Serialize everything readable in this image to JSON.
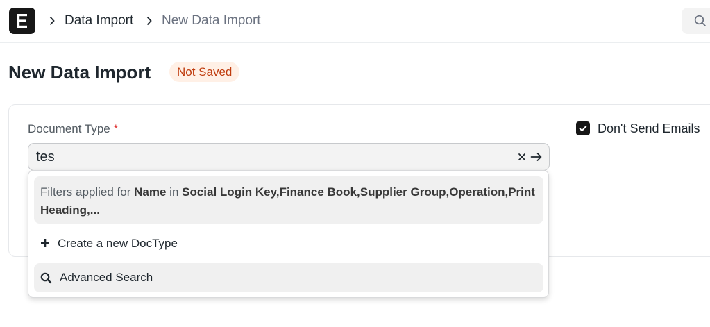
{
  "navbar": {
    "logo_icon": "erpnext-logo-icon",
    "breadcrumbs": [
      {
        "label": "Data Import"
      },
      {
        "label": "New Data Import"
      }
    ],
    "search_icon": "search-icon"
  },
  "page": {
    "title": "New Data Import",
    "status": "Not Saved",
    "status_colors": {
      "background": "#fff0e6",
      "text": "#bf3b0d"
    }
  },
  "form": {
    "document_type": {
      "label": "Document Type",
      "required_mark": "*",
      "value": "tes"
    },
    "dont_send_emails": {
      "label": "Don't Send Emails",
      "checked": true
    }
  },
  "dropdown": {
    "filter_notice": {
      "prefix": "Filters applied for ",
      "field": "Name",
      "middle": " in ",
      "values": "Social Login Key,Finance Book,Supplier Group,Operation,Print Heading,..."
    },
    "create_label": "Create a new DocType",
    "advanced_search_label": "Advanced Search"
  }
}
